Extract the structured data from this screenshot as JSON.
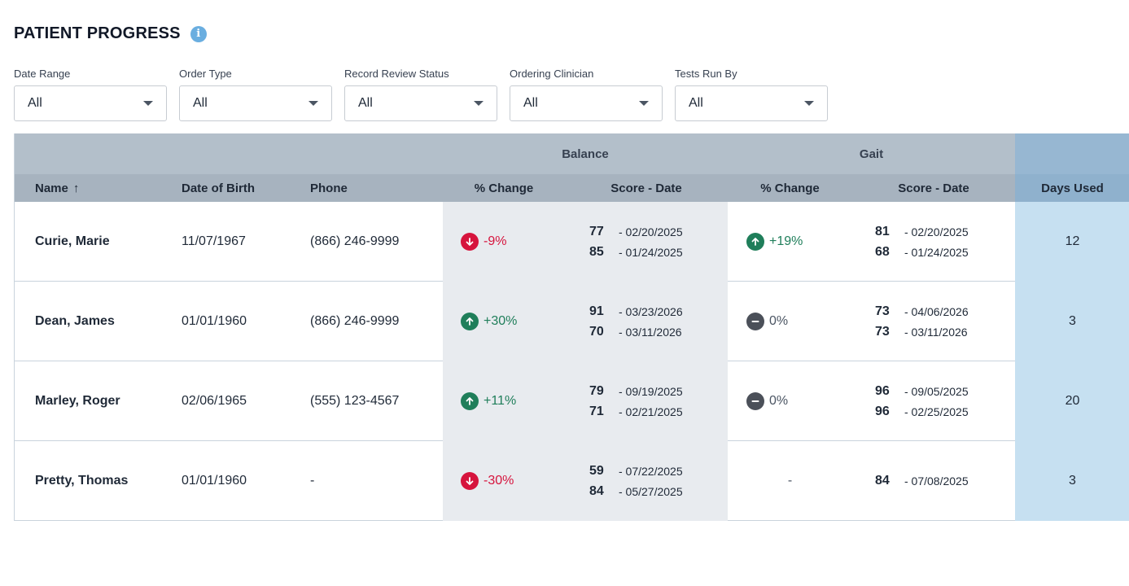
{
  "header": {
    "title": "PATIENT PROGRESS",
    "info_icon": "info-icon"
  },
  "filters": [
    {
      "label": "Date Range",
      "value": "All"
    },
    {
      "label": "Order Type",
      "value": "All"
    },
    {
      "label": "Record Review Status",
      "value": "All"
    },
    {
      "label": "Ordering Clinician",
      "value": "All"
    },
    {
      "label": "Tests Run By",
      "value": "All"
    }
  ],
  "table": {
    "groups": {
      "balance": "Balance",
      "gait": "Gait"
    },
    "columns": {
      "name": "Name",
      "sort_indicator": "↑",
      "dob": "Date of Birth",
      "phone": "Phone",
      "balance_pct": "% Change",
      "balance_score": "Score - Date",
      "gait_pct": "% Change",
      "gait_score": "Score - Date",
      "days": "Days Used"
    },
    "rows": [
      {
        "name": "Curie, Marie",
        "dob": "11/07/1967",
        "phone": "(866) 246-9999",
        "balance_pct": "-9%",
        "balance_dir": "down",
        "balance_scores": [
          {
            "score": "77",
            "date": "- 02/20/2025"
          },
          {
            "score": "85",
            "date": "- 01/24/2025"
          }
        ],
        "gait_pct": "+19%",
        "gait_dir": "up",
        "gait_scores": [
          {
            "score": "81",
            "date": "- 02/20/2025"
          },
          {
            "score": "68",
            "date": "- 01/24/2025"
          }
        ],
        "days": "12"
      },
      {
        "name": "Dean, James",
        "dob": "01/01/1960",
        "phone": "(866) 246-9999",
        "balance_pct": "+30%",
        "balance_dir": "up",
        "balance_scores": [
          {
            "score": "91",
            "date": "- 03/23/2026"
          },
          {
            "score": "70",
            "date": "- 03/11/2026"
          }
        ],
        "gait_pct": "0%",
        "gait_dir": "flat",
        "gait_scores": [
          {
            "score": "73",
            "date": "- 04/06/2026"
          },
          {
            "score": "73",
            "date": "- 03/11/2026"
          }
        ],
        "days": "3"
      },
      {
        "name": "Marley, Roger",
        "dob": "02/06/1965",
        "phone": "(555) 123-4567",
        "balance_pct": "+11%",
        "balance_dir": "up",
        "balance_scores": [
          {
            "score": "79",
            "date": "- 09/19/2025"
          },
          {
            "score": "71",
            "date": "- 02/21/2025"
          }
        ],
        "gait_pct": "0%",
        "gait_dir": "flat",
        "gait_scores": [
          {
            "score": "96",
            "date": "- 09/05/2025"
          },
          {
            "score": "96",
            "date": "- 02/25/2025"
          }
        ],
        "days": "20"
      },
      {
        "name": "Pretty, Thomas",
        "dob": "01/01/1960",
        "phone": "-",
        "balance_pct": "-30%",
        "balance_dir": "down",
        "balance_scores": [
          {
            "score": "59",
            "date": "- 07/22/2025"
          },
          {
            "score": "84",
            "date": "- 05/27/2025"
          }
        ],
        "gait_pct": "-",
        "gait_dir": "none",
        "gait_scores": [
          {
            "score": "84",
            "date": "- 07/08/2025"
          }
        ],
        "days": "3"
      }
    ]
  },
  "colors": {
    "down": "#d6143d",
    "up": "#1f7e5a",
    "flat": "#4b5059",
    "info": "#6aaee0"
  }
}
